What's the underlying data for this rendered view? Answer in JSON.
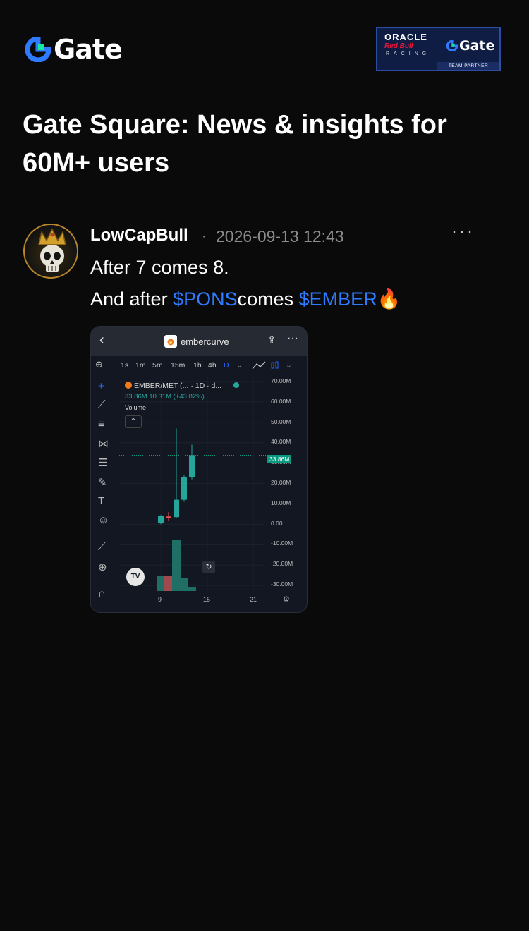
{
  "brand": {
    "name": "Gate",
    "accent": "#2f7bff"
  },
  "partner": {
    "oracle": "ORACLE",
    "redbull": "Red Bull",
    "racing": "RACING",
    "gate": "Gate",
    "team_partner": "TEAM PARTNER"
  },
  "headline": "Gate Square: News & insights for 60M+ users",
  "post": {
    "author": "LowCapBull",
    "separator": "·",
    "timestamp": "2026-09-13 12:43",
    "more": "···",
    "line1": "After 7 comes 8.",
    "line2_prefix": "And after ",
    "tag1": "$PONS",
    "line2_middle": "comes ",
    "tag2": "$EMBER",
    "emoji": "🔥"
  },
  "embedded_chart": {
    "back": "‹",
    "app_title": "embercurve",
    "share": "⇪",
    "menu": "···",
    "timeframes": [
      "1s",
      "1m",
      "5m",
      "15m",
      "1h",
      "4h",
      "D"
    ],
    "symbol": "EMBER/MET (... · 1D · d...",
    "price_line": "33.86M  10.31M (+43.82%)",
    "volume_label": "Volume",
    "price_tag": "33.86M",
    "y_ticks": [
      "70.00M",
      "60.00M",
      "50.00M",
      "40.00M",
      "30.00M",
      "20.00M",
      "10.00M",
      "0.00",
      "-10.00M",
      "-20.00M",
      "-30.00M"
    ],
    "x_ticks": [
      "9",
      "15",
      "21"
    ],
    "tv_logo": "TV"
  },
  "chart_data": {
    "type": "candlestick",
    "title": "EMBER/MET",
    "ylim": [
      -30,
      70
    ],
    "y_unit": "M",
    "candles": [
      {
        "open": 0.5,
        "close": 4.0,
        "high": 4.5,
        "low": 0.0,
        "dir": "up"
      },
      {
        "open": 3.8,
        "close": 3.5,
        "high": 6.0,
        "low": 1.5,
        "dir": "down"
      },
      {
        "open": 3.5,
        "close": 12.0,
        "high": 47.0,
        "low": 3.0,
        "dir": "up"
      },
      {
        "open": 12.0,
        "close": 23.0,
        "high": 24.0,
        "low": 11.0,
        "dir": "up"
      },
      {
        "open": 23.0,
        "close": 33.86,
        "high": 39.0,
        "low": 22.0,
        "dir": "up"
      }
    ],
    "volumes": [
      {
        "value": 7,
        "dir": "up"
      },
      {
        "value": 7,
        "dir": "down"
      },
      {
        "value": 24,
        "dir": "up"
      },
      {
        "value": 6,
        "dir": "up"
      },
      {
        "value": 2,
        "dir": "up"
      }
    ]
  }
}
